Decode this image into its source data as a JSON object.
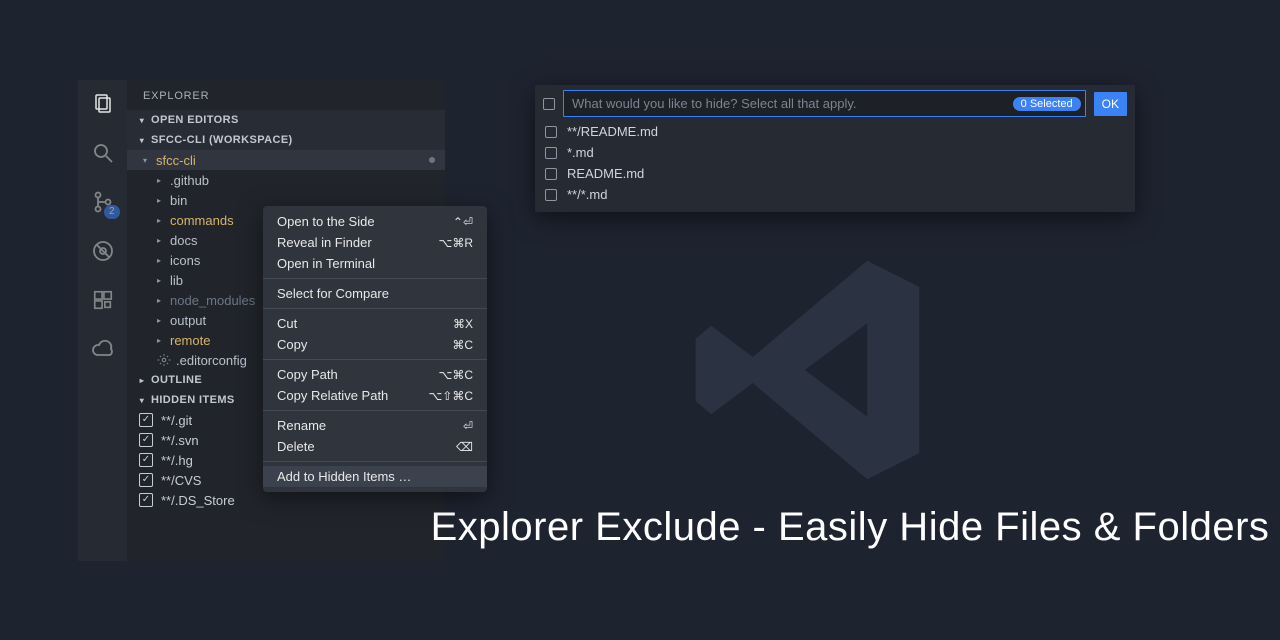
{
  "sidebar": {
    "title": "EXPLORER",
    "open_editors_header": "OPEN EDITORS",
    "workspace_header": "SFCC-CLI (WORKSPACE)",
    "root": "sfcc-cli",
    "items": [
      {
        "label": ".github"
      },
      {
        "label": "bin"
      },
      {
        "label": "commands"
      },
      {
        "label": "docs"
      },
      {
        "label": "icons"
      },
      {
        "label": "lib"
      },
      {
        "label": "node_modules"
      },
      {
        "label": "output"
      },
      {
        "label": "remote"
      },
      {
        "label": ".editorconfig"
      }
    ],
    "outline_header": "OUTLINE",
    "hidden_header": "HIDDEN ITEMS",
    "hidden_items": [
      "**/.git",
      "**/.svn",
      "**/.hg",
      "**/CVS",
      "**/.DS_Store"
    ]
  },
  "activity": {
    "scm_badge": "2"
  },
  "context_menu": {
    "open_side": {
      "label": "Open to the Side",
      "shortcut": "⌃⏎"
    },
    "reveal": {
      "label": "Reveal in Finder",
      "shortcut": "⌥⌘R"
    },
    "terminal": {
      "label": "Open in Terminal",
      "shortcut": ""
    },
    "compare": {
      "label": "Select for Compare",
      "shortcut": ""
    },
    "cut": {
      "label": "Cut",
      "shortcut": "⌘X"
    },
    "copy": {
      "label": "Copy",
      "shortcut": "⌘C"
    },
    "copy_path": {
      "label": "Copy Path",
      "shortcut": "⌥⌘C"
    },
    "copy_rel": {
      "label": "Copy Relative Path",
      "shortcut": "⌥⇧⌘C"
    },
    "rename": {
      "label": "Rename",
      "shortcut": "⏎"
    },
    "delete": {
      "label": "Delete",
      "shortcut": "⌦"
    },
    "add_hidden": {
      "label": "Add to Hidden Items …",
      "shortcut": ""
    }
  },
  "quickpick": {
    "placeholder": "What would you like to hide? Select all that apply.",
    "badge": "0 Selected",
    "ok": "OK",
    "options": [
      "**/README.md",
      "*.md",
      "README.md",
      "**/*.md"
    ]
  },
  "tagline": "Explorer Exclude - Easily Hide Files & Folders",
  "colors": {
    "accent": "#3b82f6"
  }
}
